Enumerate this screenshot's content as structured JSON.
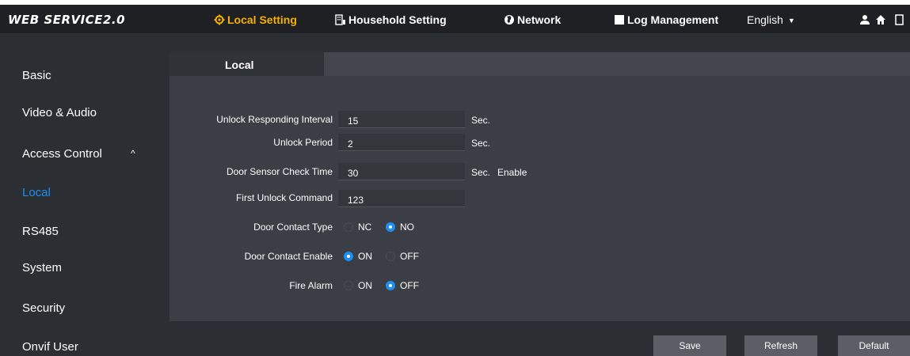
{
  "header": {
    "logo": "WEB SERVICE2.0",
    "nav": [
      {
        "label": "Local Setting",
        "icon": "gear-icon",
        "active": true
      },
      {
        "label": "Household Setting",
        "icon": "building-icon",
        "active": false
      },
      {
        "label": "Network",
        "icon": "globe-icon",
        "active": false
      },
      {
        "label": "Log Management",
        "icon": "log-icon",
        "active": false
      }
    ],
    "language": "English"
  },
  "sidebar": {
    "items": [
      {
        "label": "Basic"
      },
      {
        "label": "Video & Audio"
      },
      {
        "label": "Access Control"
      },
      {
        "label": "Local",
        "active": true
      },
      {
        "label": "RS485"
      },
      {
        "label": "System"
      },
      {
        "label": "Security"
      },
      {
        "label": "Onvif User"
      }
    ]
  },
  "main": {
    "tab": "Local",
    "fields": {
      "unlock_interval": {
        "label": "Unlock Responding Interval",
        "value": "15",
        "unit": "Sec."
      },
      "unlock_period": {
        "label": "Unlock Period",
        "value": "2",
        "unit": "Sec."
      },
      "sensor_check": {
        "label": "Door Sensor Check Time",
        "value": "30",
        "unit": "Sec.",
        "extra": "Enable"
      },
      "first_command": {
        "label": "First Unlock Command",
        "value": "123"
      }
    },
    "radios": {
      "contact_type": {
        "label": "Door Contact Type",
        "opt1": "NC",
        "opt2": "NO",
        "selected": "NO"
      },
      "contact_enable": {
        "label": "Door Contact Enable",
        "opt1": "ON",
        "opt2": "OFF",
        "selected": "ON"
      },
      "fire_alarm": {
        "label": "Fire Alarm",
        "opt1": "ON",
        "opt2": "OFF",
        "selected": "OFF"
      }
    }
  },
  "buttons": {
    "save": "Save",
    "refresh": "Refresh",
    "default": "Default"
  },
  "colors": {
    "accent": "#1e8ff0",
    "active_nav": "#f5b100",
    "background": "#2b2e33"
  }
}
